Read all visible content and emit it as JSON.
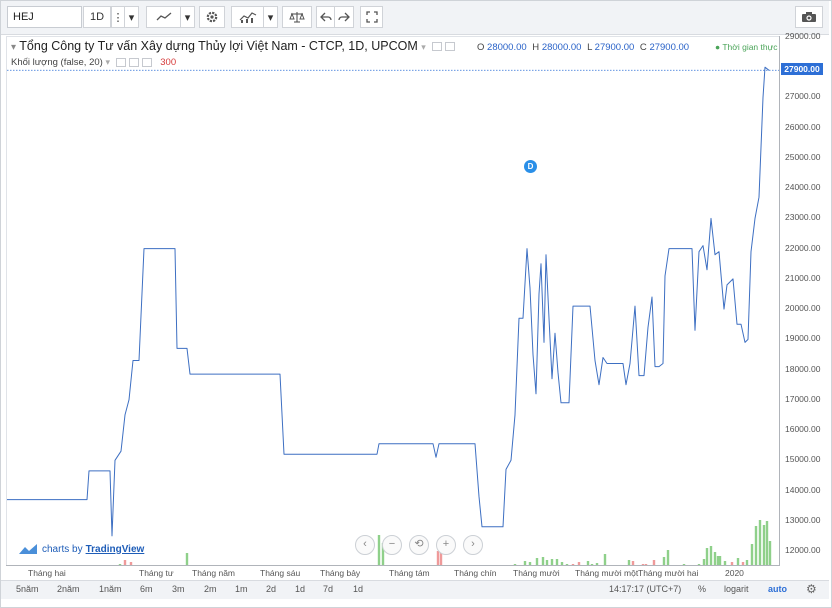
{
  "toolbar": {
    "symbol": "HEJ",
    "interval": "1D",
    "more_glyph": "⋮",
    "caret_glyph": "▾"
  },
  "legend": {
    "title": "Tổng Công ty Tư vấn Xây dựng Thủy lợi Việt Nam - CTCP, 1D, UPCOM",
    "ohlc": {
      "o_label": "O",
      "o_value": "28000.00",
      "h_label": "H",
      "h_value": "28000.00",
      "l_label": "L",
      "l_value": "27900.00",
      "c_label": "C",
      "c_value": "27900.00"
    },
    "realtime": "● Thời gian thực",
    "volume_label": "Khối lượng (false, 20)",
    "volume_value": "300"
  },
  "event_marker": "D",
  "last_price_tag": "27900.00",
  "watermark": {
    "prefix": "charts by",
    "brand": "TradingView"
  },
  "nav": [
    "‹",
    "−",
    "⟲",
    "+",
    "›"
  ],
  "bottom_bar": {
    "ranges": [
      "5năm",
      "2năm",
      "1năm",
      "6m",
      "3m",
      "2m",
      "1m",
      "2d",
      "1d",
      "7d",
      "1d"
    ],
    "time": "14:17:17 (UTC+7)",
    "percent": "%",
    "log": "logarit",
    "auto": "auto"
  },
  "colors": {
    "line": "#3d6fc2",
    "vol_up": "#8fd08a",
    "vol_down": "#ef9a9a",
    "accent": "#2d6fd6"
  },
  "chart_data": {
    "type": "line",
    "price_axis": {
      "min": 12000,
      "max": 29000,
      "step": 1000,
      "labels": [
        "12000.00",
        "13000.00",
        "14000.00",
        "15000.00",
        "16000.00",
        "17000.00",
        "18000.00",
        "19000.00",
        "20000.00",
        "21000.00",
        "22000.00",
        "23000.00",
        "24000.00",
        "25000.00",
        "26000.00",
        "27000.00",
        "28000.00",
        "29000.00"
      ]
    },
    "time_axis_labels": [
      "Tháng hai",
      "Tháng tư",
      "Tháng năm",
      "Tháng sáu",
      "Tháng bảy",
      "Tháng tám",
      "Tháng chín",
      "Tháng mười",
      "Tháng mười một",
      "Tháng mười hai",
      "2020"
    ],
    "price": [
      [
        0,
        13700
      ],
      [
        80,
        13700
      ],
      [
        82,
        14650
      ],
      [
        103,
        14650
      ],
      [
        105,
        12500
      ],
      [
        108,
        15000
      ],
      [
        114,
        15300
      ],
      [
        118,
        16500
      ],
      [
        122,
        17000
      ],
      [
        126,
        18300
      ],
      [
        132,
        18300
      ],
      [
        137,
        22000
      ],
      [
        168,
        22000
      ],
      [
        170,
        18700
      ],
      [
        180,
        18700
      ],
      [
        183,
        17850
      ],
      [
        273,
        17850
      ],
      [
        277,
        15200
      ],
      [
        370,
        15200
      ],
      [
        372,
        15550
      ],
      [
        426,
        15550
      ],
      [
        429,
        15100
      ],
      [
        432,
        15550
      ],
      [
        468,
        15550
      ],
      [
        472,
        13800
      ],
      [
        475,
        12800
      ],
      [
        496,
        12800
      ],
      [
        499,
        14700
      ],
      [
        504,
        15000
      ],
      [
        508,
        16500
      ],
      [
        512,
        19700
      ],
      [
        516,
        19700
      ],
      [
        520,
        22000
      ],
      [
        523,
        20700
      ],
      [
        526,
        18500
      ],
      [
        529,
        17200
      ],
      [
        532,
        20500
      ],
      [
        534,
        21500
      ],
      [
        537,
        18900
      ],
      [
        539,
        21800
      ],
      [
        542,
        19700
      ],
      [
        545,
        17700
      ],
      [
        548,
        19200
      ],
      [
        551,
        17900
      ],
      [
        554,
        16900
      ],
      [
        562,
        16900
      ],
      [
        566,
        20100
      ],
      [
        583,
        20100
      ],
      [
        588,
        18300
      ],
      [
        592,
        17500
      ],
      [
        596,
        18400
      ],
      [
        600,
        18200
      ],
      [
        616,
        18200
      ],
      [
        619,
        17500
      ],
      [
        623,
        18200
      ],
      [
        628,
        20100
      ],
      [
        632,
        17800
      ],
      [
        637,
        17800
      ],
      [
        641,
        19400
      ],
      [
        645,
        20400
      ],
      [
        648,
        18100
      ],
      [
        652,
        18100
      ],
      [
        656,
        18200
      ],
      [
        658,
        21100
      ],
      [
        662,
        22000
      ],
      [
        685,
        22000
      ],
      [
        688,
        19300
      ],
      [
        692,
        21900
      ],
      [
        696,
        22100
      ],
      [
        700,
        21300
      ],
      [
        704,
        23000
      ],
      [
        708,
        21800
      ],
      [
        712,
        21900
      ],
      [
        717,
        20000
      ],
      [
        720,
        20800
      ],
      [
        726,
        21000
      ],
      [
        730,
        19500
      ],
      [
        734,
        19500
      ],
      [
        738,
        18900
      ],
      [
        741,
        19000
      ],
      [
        744,
        21900
      ],
      [
        748,
        23000
      ],
      [
        752,
        23700
      ],
      [
        756,
        27000
      ],
      [
        758,
        28000
      ],
      [
        762,
        27900
      ]
    ],
    "volume": [
      [
        106,
        1
      ],
      [
        113,
        2
      ],
      [
        118,
        6
      ],
      [
        124,
        4
      ],
      [
        180,
        13
      ],
      [
        372,
        31
      ],
      [
        376,
        23
      ],
      [
        431,
        15
      ],
      [
        434,
        15
      ],
      [
        508,
        2
      ],
      [
        512,
        1
      ],
      [
        518,
        5
      ],
      [
        523,
        4
      ],
      [
        530,
        8
      ],
      [
        536,
        9
      ],
      [
        540,
        6
      ],
      [
        545,
        7
      ],
      [
        550,
        7
      ],
      [
        555,
        4
      ],
      [
        560,
        2
      ],
      [
        566,
        2
      ],
      [
        572,
        4
      ],
      [
        581,
        5
      ],
      [
        585,
        2
      ],
      [
        590,
        3
      ],
      [
        598,
        12
      ],
      [
        606,
        1
      ],
      [
        615,
        1
      ],
      [
        622,
        6
      ],
      [
        626,
        5
      ],
      [
        636,
        2
      ],
      [
        639,
        2
      ],
      [
        647,
        6
      ],
      [
        657,
        9
      ],
      [
        661,
        16
      ],
      [
        668,
        1
      ],
      [
        677,
        2
      ],
      [
        680,
        1
      ],
      [
        692,
        2
      ],
      [
        697,
        7
      ],
      [
        700,
        18
      ],
      [
        704,
        20
      ],
      [
        708,
        14
      ],
      [
        711,
        10
      ],
      [
        713,
        10
      ],
      [
        718,
        5
      ],
      [
        725,
        4
      ],
      [
        731,
        8
      ],
      [
        736,
        4
      ],
      [
        740,
        6
      ],
      [
        745,
        22
      ],
      [
        749,
        40
      ],
      [
        753,
        46
      ],
      [
        757,
        41
      ],
      [
        760,
        45
      ],
      [
        763,
        25
      ]
    ],
    "down_volume_x": [
      118,
      124,
      431,
      434,
      556,
      566,
      572,
      626,
      636,
      639,
      647,
      725,
      736
    ]
  }
}
